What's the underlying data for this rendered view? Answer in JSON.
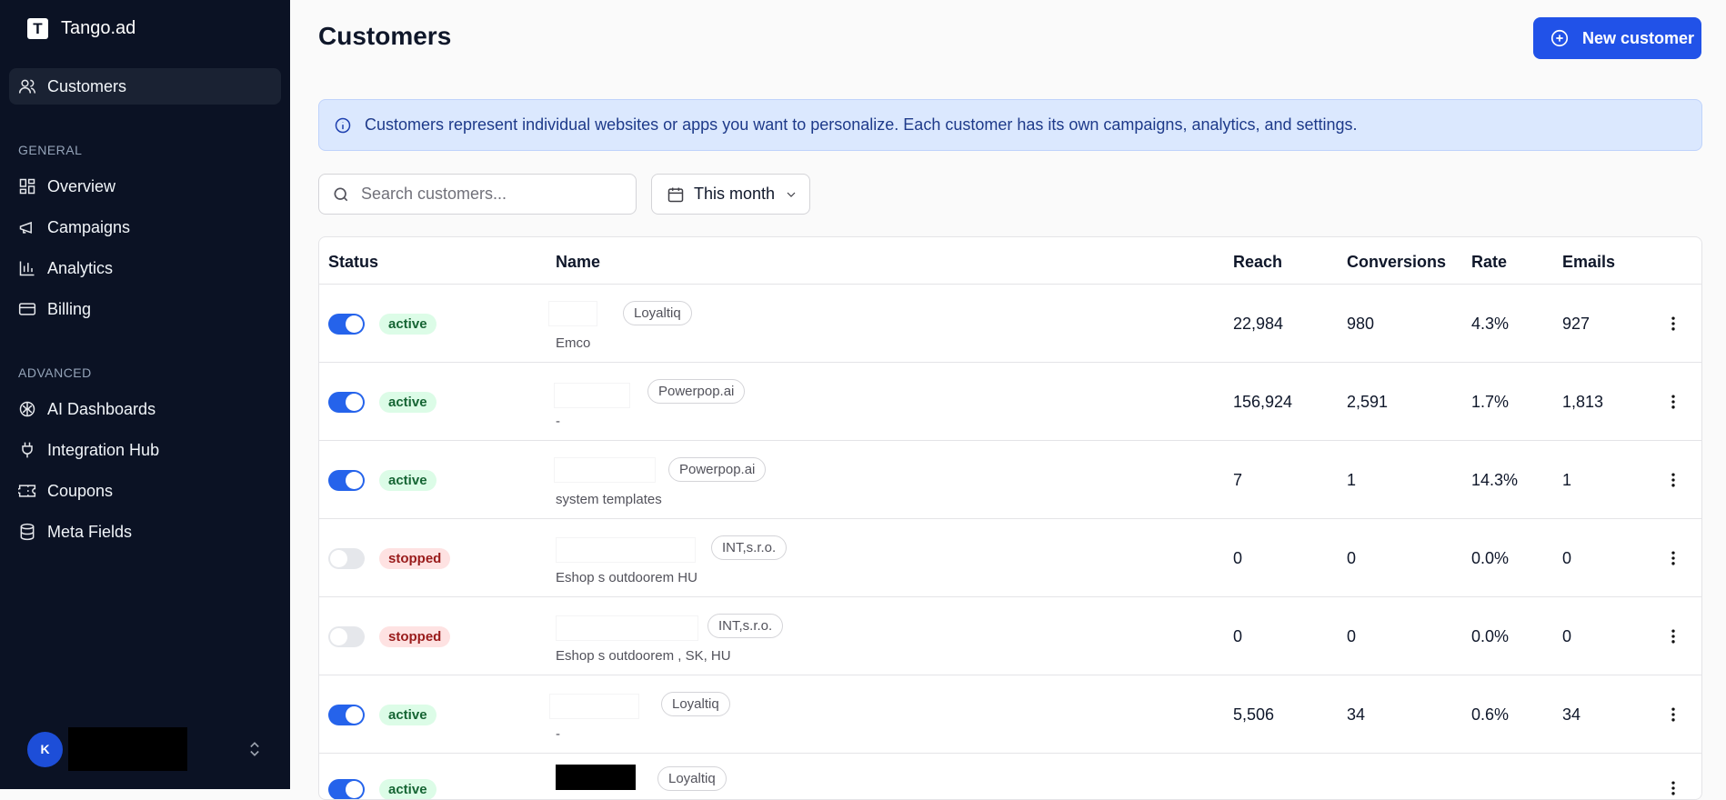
{
  "app": {
    "name": "Tango.ad",
    "logo_letter": "T"
  },
  "sidebar": {
    "primary": {
      "label": "Customers",
      "icon": "users-icon"
    },
    "general_label": "GENERAL",
    "general": [
      {
        "label": "Overview",
        "icon": "layout-dashboard-icon"
      },
      {
        "label": "Campaigns",
        "icon": "megaphone-icon"
      },
      {
        "label": "Analytics",
        "icon": "bar-chart-icon"
      },
      {
        "label": "Billing",
        "icon": "credit-card-icon"
      }
    ],
    "advanced_label": "ADVANCED",
    "advanced": [
      {
        "label": "AI Dashboards",
        "icon": "brain-icon"
      },
      {
        "label": "Integration Hub",
        "icon": "plug-icon"
      },
      {
        "label": "Coupons",
        "icon": "ticket-icon"
      },
      {
        "label": "Meta Fields",
        "icon": "database-icon"
      }
    ],
    "user": {
      "initial": "K"
    }
  },
  "header": {
    "title": "Customers",
    "new_button": "New customer"
  },
  "info_banner": "Customers represent individual websites or apps you want to personalize. Each customer has its own campaigns, analytics, and settings.",
  "filters": {
    "search_placeholder": "Search customers...",
    "date_range": "This month"
  },
  "table": {
    "columns": [
      "Status",
      "Name",
      "Reach",
      "Conversions",
      "Rate",
      "Emails"
    ],
    "rows": [
      {
        "enabled": true,
        "status": "active",
        "org": "Loyaltiq",
        "name": "Emco",
        "reach": "22,984",
        "conversions": "980",
        "rate": "4.3%",
        "emails": "927"
      },
      {
        "enabled": true,
        "status": "active",
        "org": "Powerpop.ai",
        "name": "-",
        "reach": "156,924",
        "conversions": "2,591",
        "rate": "1.7%",
        "emails": "1,813"
      },
      {
        "enabled": true,
        "status": "active",
        "org": "Powerpop.ai",
        "name": "system templates",
        "reach": "7",
        "conversions": "1",
        "rate": "14.3%",
        "emails": "1"
      },
      {
        "enabled": false,
        "status": "stopped",
        "org": "INT,s.r.o.",
        "name": "Eshop s outdoorem HU",
        "reach": "0",
        "conversions": "0",
        "rate": "0.0%",
        "emails": "0"
      },
      {
        "enabled": false,
        "status": "stopped",
        "org": "INT,s.r.o.",
        "name": "Eshop s outdoorem , SK, HU",
        "reach": "0",
        "conversions": "0",
        "rate": "0.0%",
        "emails": "0"
      },
      {
        "enabled": true,
        "status": "active",
        "org": "Loyaltiq",
        "name": "-",
        "reach": "5,506",
        "conversions": "34",
        "rate": "0.6%",
        "emails": "34"
      },
      {
        "enabled": true,
        "status": "active",
        "org": "Loyaltiq",
        "name": "",
        "reach": "",
        "conversions": "",
        "rate": "",
        "emails": ""
      }
    ]
  },
  "colors": {
    "sidebar_bg": "#0b1224",
    "accent": "#2152e8",
    "info_bg": "#dbe8fe",
    "active_badge": "#dcfce7",
    "stopped_badge": "#fee2e2"
  }
}
